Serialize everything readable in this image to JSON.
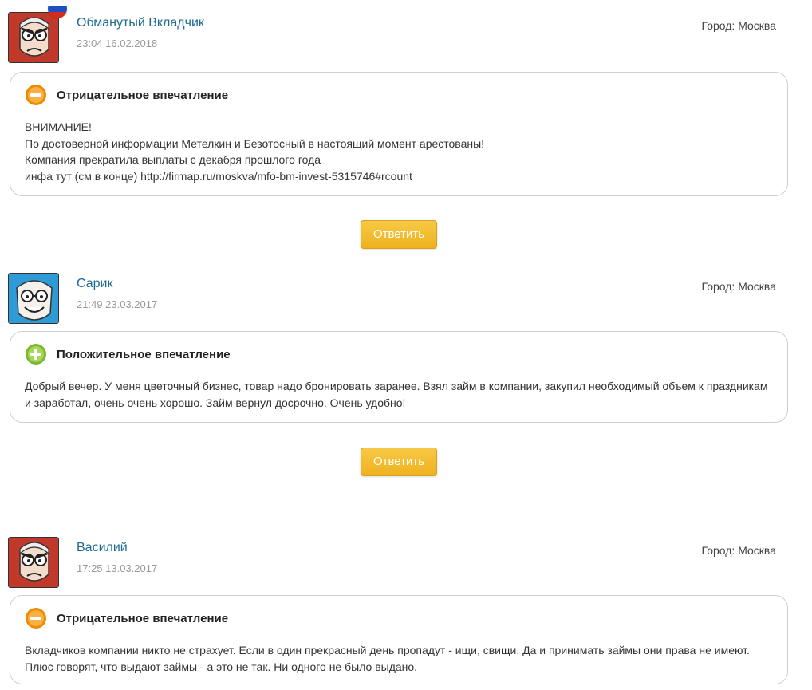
{
  "reviews": [
    {
      "author": "Обманутый Вкладчик",
      "datetime": "23:04 16.02.2018",
      "city": "Город: Москва",
      "sentiment": "negative",
      "sentiment_label": "Отрицательное впечатление",
      "text": "ВНИМАНИЕ!\nПо достоверной информации Метелкин и Безотосный в настоящий момент арестованы!\nКомпания прекратила выплаты с декабря прошлого года\nинфа тут (см в конце) http://firmap.ru/moskva/mfo-bm-invest-5315746#rcount",
      "avatar": "angry-face-avatar",
      "has_flag": true,
      "reply_label": "Ответить"
    },
    {
      "author": "Сарик",
      "datetime": "21:49 23.03.2017",
      "city": "Город: Москва",
      "sentiment": "positive",
      "sentiment_label": "Положительное впечатление",
      "text": "Добрый вечер. У меня цветочный бизнес, товар надо бронировать заранее. Взял займ в компании, закупил необходимый объем к праздникам и заработал, очень очень хорошо. Займ вернул досрочно. Очень удобно!",
      "avatar": "happy-face-avatar",
      "reply_label": "Ответить"
    },
    {
      "author": "Василий",
      "datetime": "17:25 13.03.2017",
      "city": "Город: Москва",
      "sentiment": "negative",
      "sentiment_label": "Отрицательное впечатление",
      "text": "Вкладчиков компании никто не страхует. Если в один прекрасный день пропадут - ищи, свищи. Да и принимать займы они права не имеют. Плюс говорят, что выдают займы - а это не так. Ни одного не было выдано.",
      "avatar": "angry-face-avatar"
    }
  ],
  "colors": {
    "author_link": "#1a6a8e",
    "reply_button": "#f2bb2c",
    "negative_icon": "#f08a00",
    "positive_icon": "#8cc63f"
  }
}
